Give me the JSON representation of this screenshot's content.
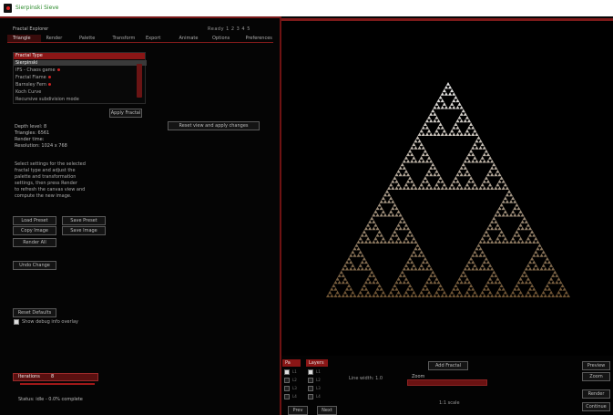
{
  "window": {
    "title": "Sierpinski Sieve"
  },
  "left": {
    "subtitle": "Fractal Explorer",
    "status": "Ready  1 2 3 4 5",
    "tabs": [
      "Triangle",
      "Render",
      "Palette",
      "Transform",
      "Export",
      "Animate",
      "Options",
      "Preferences"
    ],
    "list": {
      "header": "Fractal Type",
      "items": [
        {
          "label": "Sierpinski",
          "selected": true
        },
        {
          "label": "  IFS - Chaos game",
          "dot": true
        },
        {
          "label": "Fractal Flame",
          "dot": true
        },
        {
          "label": "Barnsley Fern",
          "dot": true
        },
        {
          "label": "Koch Curve",
          "dot": false
        },
        {
          "label": "  Recursive subdivision mode",
          "dot": false
        }
      ],
      "button": "Apply Fractal"
    },
    "wide_button": "Reset view and apply changes",
    "info": [
      "Depth level: 8",
      "Triangles: 6561",
      "Render time: ",
      "Resolution:           1024 x 768"
    ],
    "description": [
      "  Select settings for the selected",
      "    fractal type and adjust the",
      "    palette and transformation",
      "    settings, then press Render",
      "  to refresh the canvas view and",
      "  compute the new image."
    ],
    "buttons": [
      "Load Preset",
      "Save Preset",
      "Copy Image",
      "Save Image",
      "Render All",
      "Undo Change",
      "Reset Defaults"
    ],
    "checkbox_label": "Show debug info overlay",
    "slider": {
      "label": "Iterations",
      "value": "8"
    },
    "footer": "Status: idle - 0.0% complete"
  },
  "controls": {
    "tab1": "Pa",
    "tab2": "Layers",
    "rows": [
      "L1",
      "L2",
      "L3",
      "L4"
    ],
    "label_mid": "Line width: 1.0",
    "button_top": "Add Fractal",
    "small_label": "Zoom",
    "foot_label": "1:1 scale",
    "btn1": "Prev",
    "btn2": "Next",
    "side": [
      "Preview",
      "Zoom",
      "Render",
      "Continue"
    ]
  },
  "colors": {
    "accent": "#8a1616",
    "fractal_top": "#e6e6e6",
    "fractal_bottom": "#6e5332"
  },
  "fractal": {
    "depth": 6
  }
}
